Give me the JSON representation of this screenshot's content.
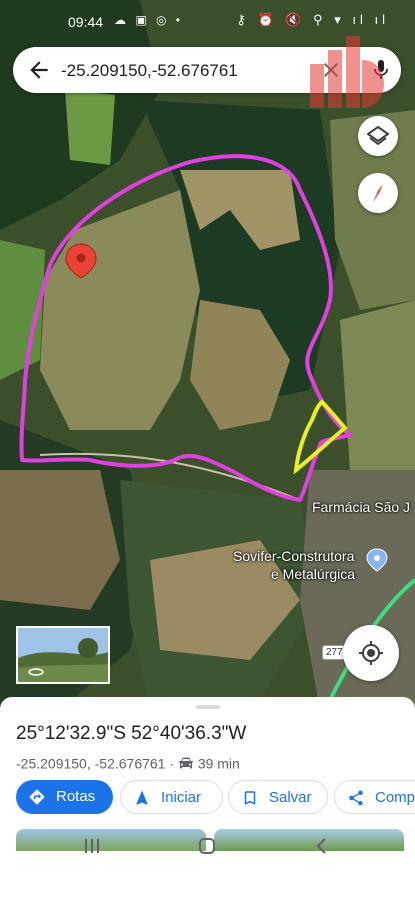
{
  "status_bar": {
    "time": "09:44",
    "left_icons": "☁ ▣ ◎ •",
    "right_icons": "⚷ ⏰ 🔇 ⚲ ▾ ıl ıl"
  },
  "search": {
    "query": "-25.209150,-52.676761"
  },
  "map": {
    "labels": {
      "farmacia": "Farmácia São J",
      "sovifer_line1": "Sovifer-Construtora",
      "sovifer_line2": "e Metalúrgica"
    },
    "road_number": "277"
  },
  "place": {
    "dms": "25°12'32.9\"S 52°40'36.3\"W",
    "decimal": "-25.209150, -52.676761",
    "separator": "·",
    "drive_time": "39 min"
  },
  "actions": {
    "rotas": "Rotas",
    "iniciar": "Iniciar",
    "salvar": "Salvar",
    "compartilhar": "Comp"
  },
  "colors": {
    "accent": "#1a73e8",
    "boundary": "#e040e0",
    "highlight": "#e8f020",
    "pin": "#ea4335"
  }
}
